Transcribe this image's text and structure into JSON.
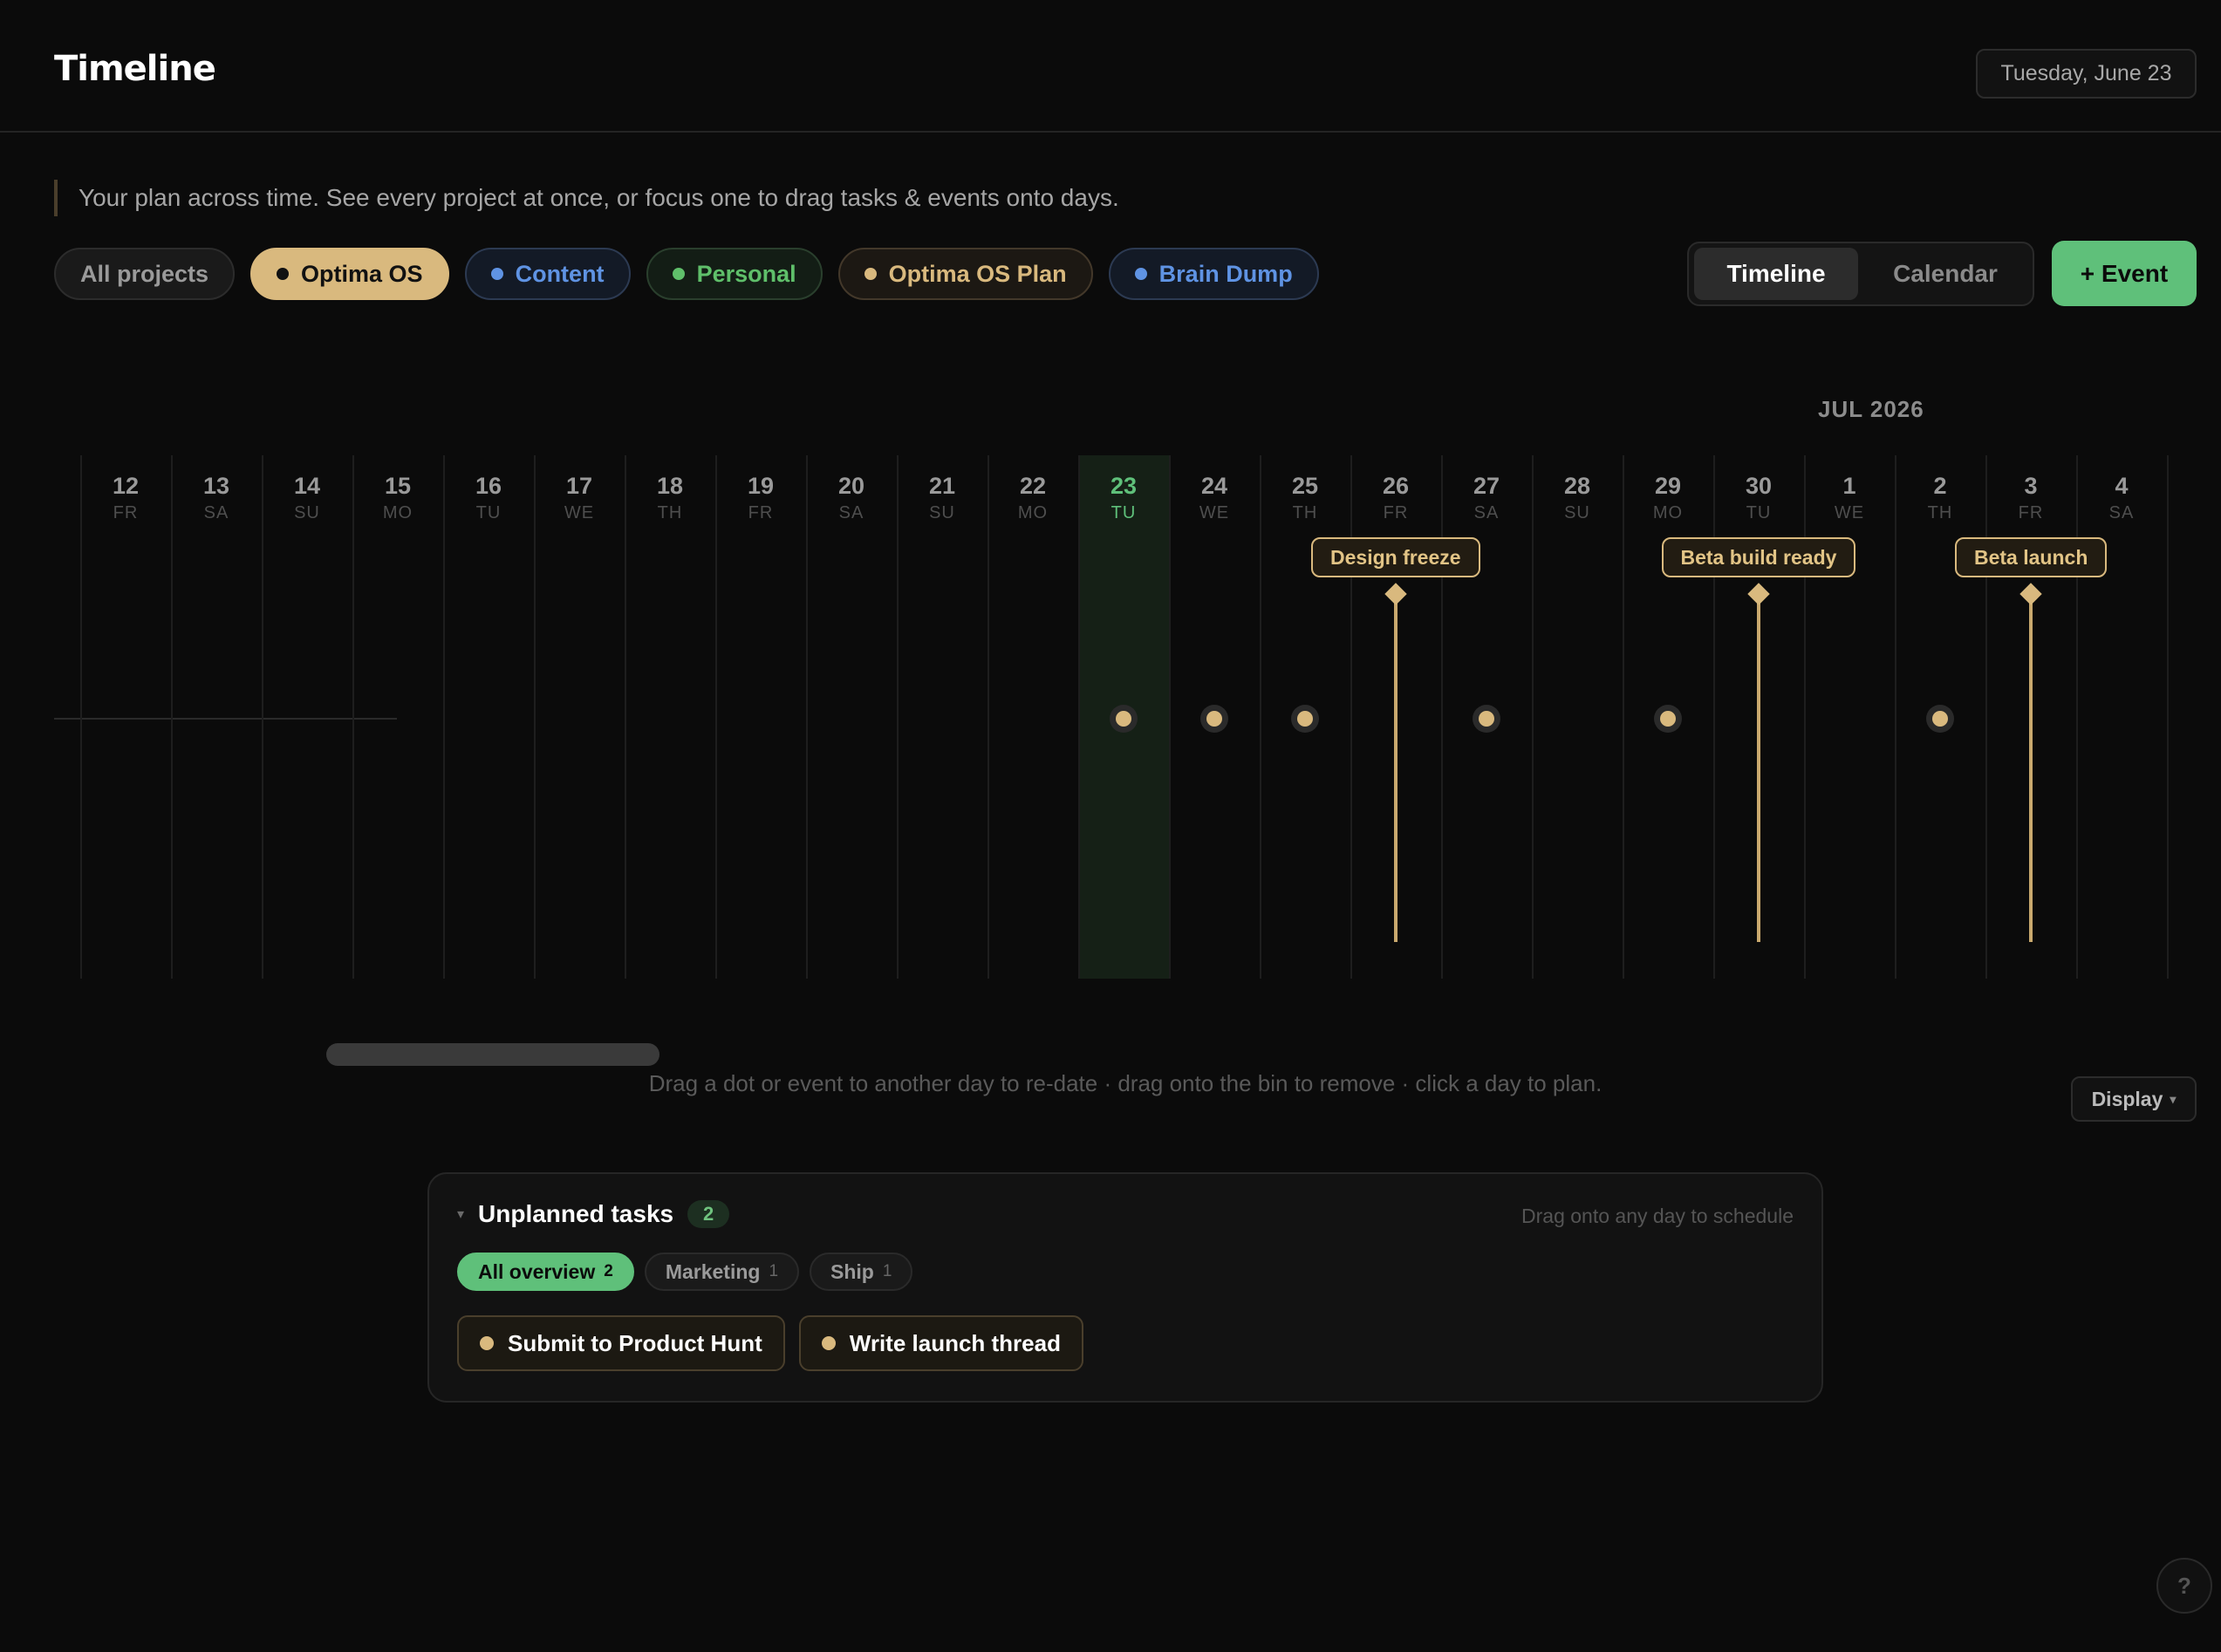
{
  "header": {
    "title": "Timeline",
    "date": "Tuesday, June 23"
  },
  "subtitle": "Your plan across time. See every project at once, or focus one to drag tasks & events onto days.",
  "filters": [
    {
      "label": "All projects"
    },
    {
      "label": "Optima OS",
      "color": "#111111"
    },
    {
      "label": "Content",
      "color": "#5f93e3"
    },
    {
      "label": "Personal",
      "color": "#5fbf6a"
    },
    {
      "label": "Optima OS Plan",
      "color": "#d9b97e"
    },
    {
      "label": "Brain Dump",
      "color": "#5f93e3"
    }
  ],
  "selected_filter": "Optima OS",
  "view_toggle": {
    "timeline": "Timeline",
    "calendar": "Calendar",
    "active": "Timeline"
  },
  "add_event_label": "+ Event",
  "month_label": "JUL 2026",
  "days": [
    {
      "num": "12",
      "wd": "FR"
    },
    {
      "num": "13",
      "wd": "SA"
    },
    {
      "num": "14",
      "wd": "SU"
    },
    {
      "num": "15",
      "wd": "MO"
    },
    {
      "num": "16",
      "wd": "TU"
    },
    {
      "num": "17",
      "wd": "WE"
    },
    {
      "num": "18",
      "wd": "TH"
    },
    {
      "num": "19",
      "wd": "FR"
    },
    {
      "num": "20",
      "wd": "SA"
    },
    {
      "num": "21",
      "wd": "SU"
    },
    {
      "num": "22",
      "wd": "MO"
    },
    {
      "num": "23",
      "wd": "TU"
    },
    {
      "num": "24",
      "wd": "WE"
    },
    {
      "num": "25",
      "wd": "TH"
    },
    {
      "num": "26",
      "wd": "FR"
    },
    {
      "num": "27",
      "wd": "SA"
    },
    {
      "num": "28",
      "wd": "SU"
    },
    {
      "num": "29",
      "wd": "MO"
    },
    {
      "num": "30",
      "wd": "TU"
    },
    {
      "num": "1",
      "wd": "WE"
    },
    {
      "num": "2",
      "wd": "TH"
    },
    {
      "num": "3",
      "wd": "FR"
    },
    {
      "num": "4",
      "wd": "SA"
    }
  ],
  "today": "23",
  "task_dots": [
    "23",
    "24",
    "25",
    "27",
    "29",
    "2"
  ],
  "events": [
    {
      "label": "Design freeze",
      "day": "26"
    },
    {
      "label": "Beta build ready",
      "day": "30"
    },
    {
      "label": "Beta launch",
      "day": "3"
    }
  ],
  "hint": "Drag a dot or event to another day to re-date · drag onto the bin to remove · click a day to plan.",
  "display_label": "Display",
  "unplanned": {
    "title": "Unplanned tasks",
    "count": "2",
    "hint": "Drag onto any day to schedule",
    "tabs": [
      {
        "label": "All overview",
        "count": "2"
      },
      {
        "label": "Marketing",
        "count": "1"
      },
      {
        "label": "Ship",
        "count": "1"
      }
    ],
    "active_tab": "All overview",
    "tasks": [
      "Submit to Product Hunt",
      "Write launch thread"
    ]
  },
  "help_label": "?"
}
